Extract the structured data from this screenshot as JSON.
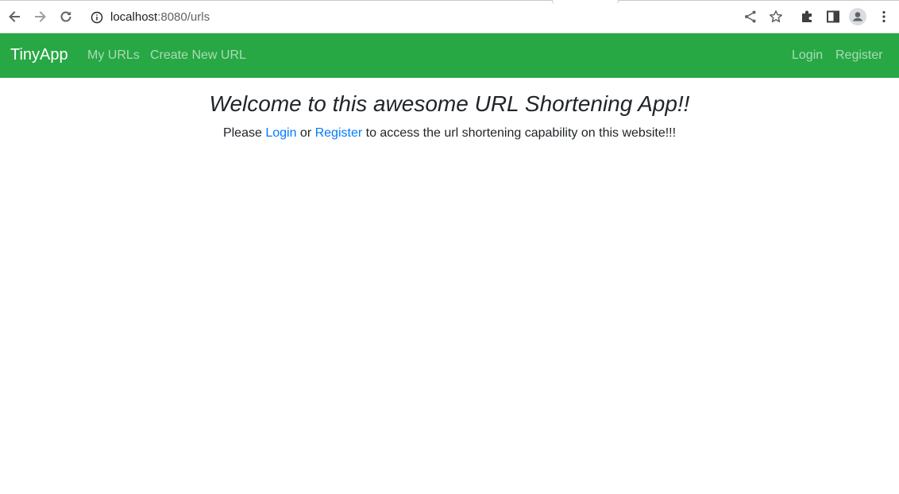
{
  "browser": {
    "url_host": "localhost",
    "url_rest": ":8080/urls",
    "icons": {
      "back": "arrow-left-icon",
      "forward": "arrow-right-icon",
      "reload": "reload-icon",
      "site_info": "info-icon",
      "share": "share-icon",
      "bookmark": "star-icon",
      "extensions": "puzzle-icon",
      "side_panel": "side-panel-icon",
      "profile": "profile-icon",
      "menu": "kebab-menu-icon"
    }
  },
  "navbar": {
    "brand": "TinyApp",
    "links": {
      "my_urls": "My URLs",
      "create_new_url": "Create New URL",
      "login": "Login",
      "register": "Register"
    },
    "background_color": "#28a745"
  },
  "main": {
    "heading": "Welcome to this awesome URL Shortening App!!",
    "prompt": {
      "before": "Please ",
      "login_link": "Login",
      "middle": " or ",
      "register_link": "Register",
      "after": " to access the url shortening capability on this website!!!"
    },
    "link_color": "#007bff"
  }
}
